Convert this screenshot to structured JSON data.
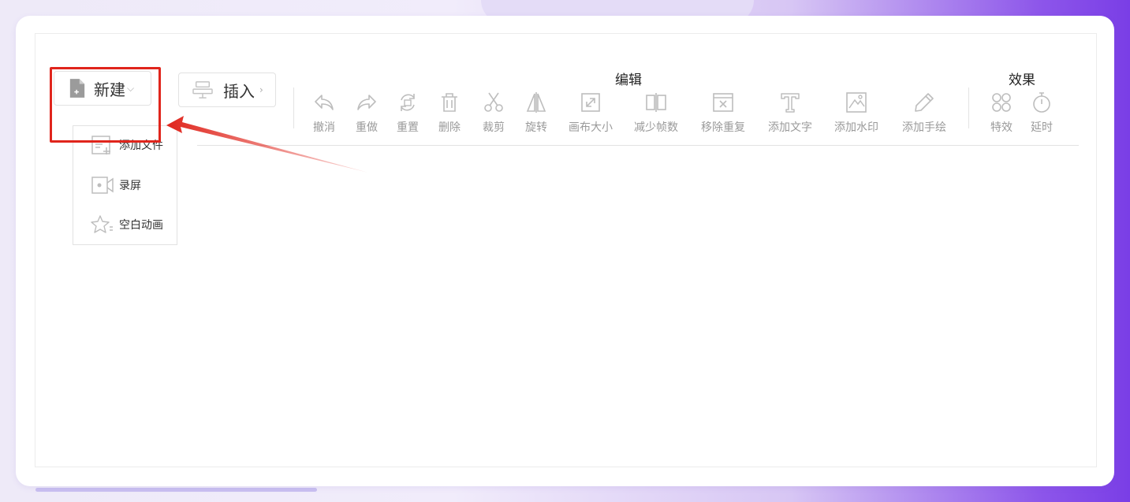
{
  "toolbar": {
    "new_label": "新建",
    "insert_label": "插入",
    "group_edit": "编辑",
    "group_effect": "效果",
    "tools": [
      {
        "label": "撤消",
        "icon": "undo-icon"
      },
      {
        "label": "重做",
        "icon": "redo-icon"
      },
      {
        "label": "重置",
        "icon": "reset-icon"
      },
      {
        "label": "删除",
        "icon": "trash-icon"
      },
      {
        "label": "裁剪",
        "icon": "scissors-icon"
      },
      {
        "label": "旋转",
        "icon": "flip-icon"
      },
      {
        "label": "画布大小",
        "icon": "canvas-resize-icon"
      },
      {
        "label": "减少帧数",
        "icon": "reduce-frames-icon"
      },
      {
        "label": "移除重复",
        "icon": "remove-duplicate-icon"
      },
      {
        "label": "添加文字",
        "icon": "text-icon"
      },
      {
        "label": "添加水印",
        "icon": "watermark-icon"
      },
      {
        "label": "添加手绘",
        "icon": "pencil-icon"
      }
    ],
    "effects": [
      {
        "label": "特效",
        "icon": "effects-icon"
      },
      {
        "label": "延时",
        "icon": "timer-icon"
      }
    ]
  },
  "dropdown": {
    "items": [
      {
        "label": "添加文件",
        "icon": "add-file-icon"
      },
      {
        "label": "录屏",
        "icon": "screen-record-icon"
      },
      {
        "label": "空白动画",
        "icon": "blank-animation-icon"
      }
    ]
  },
  "colors": {
    "highlight": "#e0251c",
    "icon_gray": "#bdbdbd",
    "label_gray": "#9a9a9a"
  }
}
